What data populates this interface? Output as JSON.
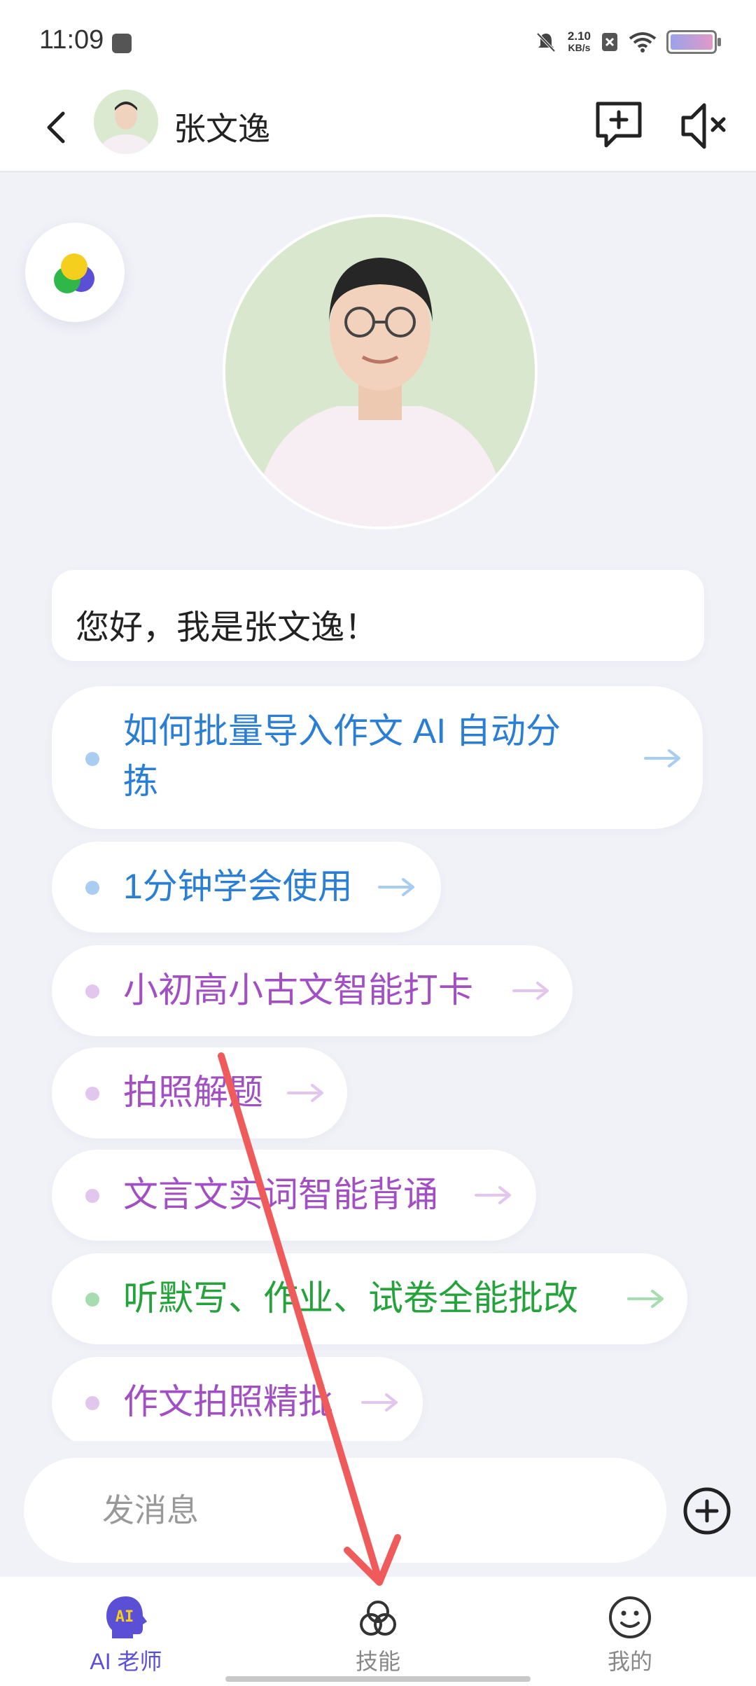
{
  "status_bar": {
    "time": "11:09",
    "net_speed_value": "2.10",
    "net_speed_unit": "KB/s"
  },
  "header": {
    "title": "张文逸"
  },
  "greeting": {
    "text": "您好，我是张文逸！"
  },
  "suggestions": [
    {
      "line1": "如何批量导入作文 AI 自动分",
      "line2": "拣",
      "color": "#2a7fd4",
      "dot_color": "#a9cdf2"
    },
    {
      "line1": "1分钟学会使用",
      "color": "#2a7fd4",
      "dot_color": "#a9cdf2"
    },
    {
      "line1": "小初高小古文智能打卡",
      "color": "#a24fc4",
      "dot_color": "#e2c6ee"
    },
    {
      "line1": "拍照解题",
      "color": "#a24fc4",
      "dot_color": "#e2c6ee"
    },
    {
      "line1": "文言文实词智能背诵",
      "color": "#a24fc4",
      "dot_color": "#e2c6ee"
    },
    {
      "line1": "听默写、作业、试卷全能批改",
      "color": "#23a33a",
      "dot_color": "#a6dcb0"
    },
    {
      "line1": "作文拍照精批",
      "color": "#a24fc4",
      "dot_color": "#e2c6ee"
    }
  ],
  "input": {
    "placeholder": "发消息"
  },
  "bottom_nav": {
    "items": [
      {
        "label": "AI 老师",
        "icon": "ai-teacher-icon",
        "active": true
      },
      {
        "label": "技能",
        "icon": "skills-icon",
        "active": false
      },
      {
        "label": "我的",
        "icon": "smiley-icon",
        "active": false
      }
    ],
    "active_color": "#5b4fd6",
    "ai_badge_text": "AI"
  },
  "colors": {
    "background": "#f1f2f8",
    "annotation_arrow": "#ef5a5a"
  }
}
